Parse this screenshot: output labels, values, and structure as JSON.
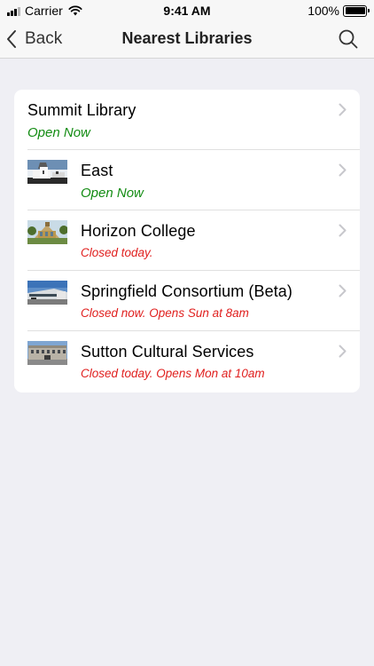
{
  "status_bar": {
    "carrier": "Carrier",
    "time": "9:41 AM",
    "battery": "100%"
  },
  "nav": {
    "back_label": "Back",
    "title": "Nearest Libraries"
  },
  "colors": {
    "open": "#138c13",
    "closed": "#e0201f"
  },
  "libraries": [
    {
      "name": "Summit Library",
      "status": "Open Now",
      "state": "open",
      "thumbnail": "none"
    },
    {
      "name": "East",
      "status": "Open Now",
      "state": "open",
      "thumbnail": "building-photo"
    },
    {
      "name": "Horizon College",
      "status": "Closed today.",
      "state": "closed",
      "thumbnail": "building-photo"
    },
    {
      "name": "Springfield Consortium (Beta)",
      "status": "Closed now. Opens Sun at 8am",
      "state": "closed",
      "thumbnail": "building-photo"
    },
    {
      "name": "Sutton Cultural Services",
      "status": "Closed today. Opens Mon at 10am",
      "state": "closed",
      "thumbnail": "building-photo"
    }
  ]
}
